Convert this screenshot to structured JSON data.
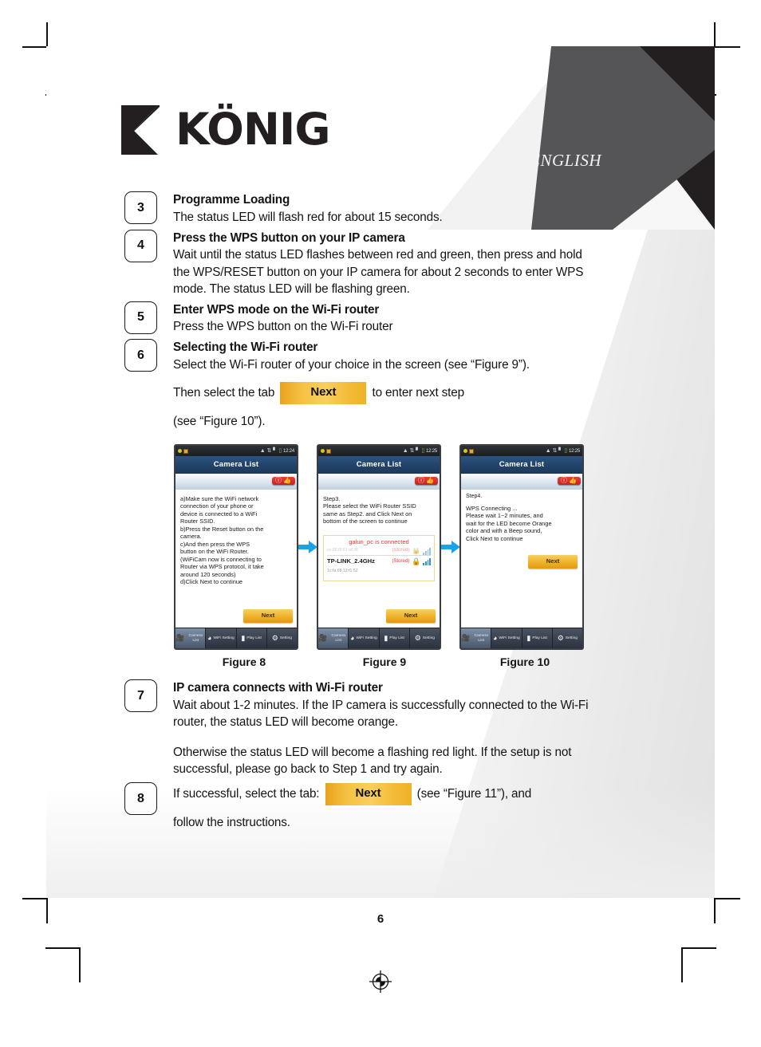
{
  "header": {
    "language_label": "ENGLISH",
    "brand": "KÖNIG"
  },
  "page_number": "6",
  "steps": [
    {
      "number": "3",
      "title": "Programme Loading",
      "text": "The status LED will flash red for about 15 seconds."
    },
    {
      "number": "4",
      "title": "Press the WPS button on your IP camera",
      "text": "Wait until the status LED flashes between red and green, then press and hold the WPS/RESET button on your IP camera for about 2 seconds to enter WPS mode. The status LED will be flashing green."
    },
    {
      "number": "5",
      "title": "Enter WPS mode on the Wi-Fi router",
      "text": "Press the WPS button on the Wi-Fi router"
    },
    {
      "number": "6",
      "title": "Selecting the Wi-Fi router",
      "text": "Select the Wi-Fi router of your choice in the screen (see “Figure 9”).",
      "text_2_before": "Then select the tab",
      "button_label": "Next",
      "text_2_after": "to enter next step",
      "text_3": "(see “Figure 10”)."
    },
    {
      "number": "7",
      "title": "IP camera connects with Wi-Fi router",
      "text": "Wait about 1-2 minutes. If the IP camera is successfully connected to the Wi-Fi router, the status LED will become orange.",
      "text_2": "Otherwise the status LED will become a flashing red light. If the setup is not successful, please go back to Step 1 and try again."
    },
    {
      "number": "8",
      "text_before": "If successful, select the tab:",
      "button_label": "Next",
      "text_after": "(see “Figure 11”), and",
      "text_2": "follow the instructions."
    }
  ],
  "figures": [
    {
      "caption": "Figure 8",
      "status_time": "12:24",
      "title": "Camera List",
      "body_lines": [
        "a)Make sure the WiFi network",
        "connection of your phone or",
        "device is connected to a WiFi",
        "Router SSID.",
        "b)Press the Reset button on the",
        "camera.",
        "c)And then press the WPS",
        "button on the WiFi Router.",
        "(WiFiCam now is connecting to",
        "Router via WPS protocol, it take",
        "around 120 seconds)",
        "d)Click Next to continue"
      ],
      "next_label": "Next",
      "tabs": [
        "Camera List",
        "WiFi Setting",
        "Play List",
        "Setting"
      ]
    },
    {
      "caption": "Figure 9",
      "status_time": "12:25",
      "title": "Camera List",
      "body_lines": [
        "Step3.",
        "Please select the WiFi Router SSID",
        "same as Step2. and Click Next on",
        "bottom of the screen to continue"
      ],
      "connected_note": "galun_pc is connected",
      "ap_list": [
        {
          "ssid": "",
          "mac": "ec:88:8f:61:a6:f8",
          "stored": "(Stored)"
        },
        {
          "ssid": "TP-LINK_2.4GHz",
          "mac": "1c:fa:68:13:f1:52",
          "stored": "(Stored)"
        }
      ],
      "next_label": "Next",
      "tabs": [
        "Camera List",
        "WiFi Setting",
        "Play List",
        "Setting"
      ]
    },
    {
      "caption": "Figure 10",
      "status_time": "12:25",
      "title": "Camera List",
      "step_label": "Step4.",
      "body_lines": [
        "WPS Connecting ...",
        "Please wait 1~2 minutes, and",
        "wait for the LED become Orange",
        "color and with a Beep sound,",
        "Click Next to continue"
      ],
      "next_label": "Next",
      "tabs": [
        "Camera List",
        "WiFi Setting",
        "Play List",
        "Setting"
      ]
    }
  ],
  "colors": {
    "next_button_gold": "#f0b52c",
    "phone_title_blue": "#224369",
    "arrow_blue": "#1aa3e8",
    "alert_red": "#e8382f"
  }
}
